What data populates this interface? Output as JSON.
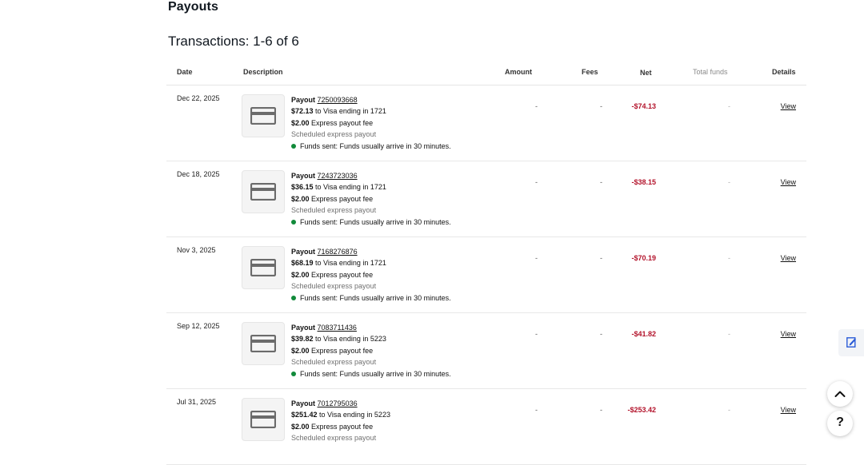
{
  "page": {
    "title": "Payouts",
    "transactions_label": "Transactions: 1-6 of 6"
  },
  "table": {
    "headers": {
      "date": "Date",
      "description": "Description",
      "amount": "Amount",
      "fees": "Fees",
      "net": "Net",
      "total_funds": "Total funds",
      "details": "Details"
    },
    "rows": [
      {
        "date": "Dec 22, 2025",
        "payout_label": "Payout",
        "payout_id": "7250093668",
        "amount_bold": "$72.13",
        "amount_rest": " to Visa ending in 1721",
        "fee_bold": "$2.00",
        "fee_rest": " Express payout fee",
        "type": "Scheduled express payout",
        "status": "Funds sent: Funds usually arrive in 30 minutes.",
        "amount": "-",
        "fees": "-",
        "net": "-$74.13",
        "total": "-",
        "details": "View"
      },
      {
        "date": "Dec 18, 2025",
        "payout_label": "Payout",
        "payout_id": "7243723036",
        "amount_bold": "$36.15",
        "amount_rest": " to Visa ending in 1721",
        "fee_bold": "$2.00",
        "fee_rest": " Express payout fee",
        "type": "Scheduled express payout",
        "status": "Funds sent: Funds usually arrive in 30 minutes.",
        "amount": "-",
        "fees": "-",
        "net": "-$38.15",
        "total": "-",
        "details": "View"
      },
      {
        "date": "Nov 3, 2025",
        "payout_label": "Payout",
        "payout_id": "7168276876",
        "amount_bold": "$68.19",
        "amount_rest": " to Visa ending in 1721",
        "fee_bold": "$2.00",
        "fee_rest": " Express payout fee",
        "type": "Scheduled express payout",
        "status": "Funds sent: Funds usually arrive in 30 minutes.",
        "amount": "-",
        "fees": "-",
        "net": "-$70.19",
        "total": "-",
        "details": "View"
      },
      {
        "date": "Sep 12, 2025",
        "payout_label": "Payout",
        "payout_id": "7083711436",
        "amount_bold": "$39.82",
        "amount_rest": " to Visa ending in 5223",
        "fee_bold": "$2.00",
        "fee_rest": " Express payout fee",
        "type": "Scheduled express payout",
        "status": "Funds sent: Funds usually arrive in 30 minutes.",
        "amount": "-",
        "fees": "-",
        "net": "-$41.82",
        "total": "-",
        "details": "View"
      },
      {
        "date": "Jul 31, 2025",
        "payout_label": "Payout",
        "payout_id": "7012795036",
        "amount_bold": "$251.42",
        "amount_rest": " to Visa ending in 5223",
        "fee_bold": "$2.00",
        "fee_rest": " Express payout fee",
        "type": "Scheduled express payout",
        "status": "",
        "amount": "-",
        "fees": "-",
        "net": "-$253.42",
        "total": "-",
        "details": "View"
      }
    ]
  },
  "floating": {
    "help_label": "?",
    "feedback_icon": "edit-icon",
    "up_icon": "chevron-up-icon"
  },
  "colors": {
    "net_negative": "#b3132b",
    "status_dot": "#118a3a"
  }
}
